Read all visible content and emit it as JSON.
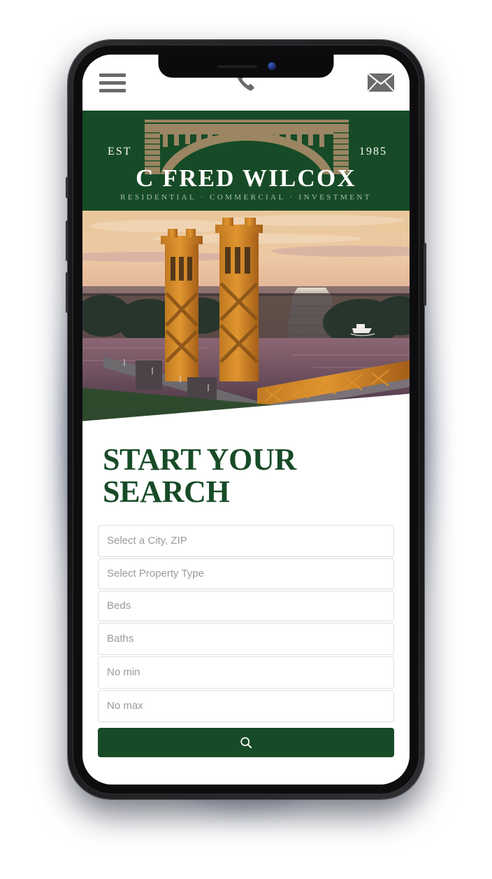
{
  "header": {
    "menu_icon": "hamburger-menu-icon",
    "phone_icon": "phone-icon",
    "mail_icon": "envelope-icon"
  },
  "logo": {
    "est_label": "EST",
    "est_year": "1985",
    "brand_name": "C FRED WILCOX",
    "tagline": "RESIDENTIAL  ·  COMMERCIAL  ·  INVESTMENT",
    "bridge_icon": "arch-bridge-icon",
    "band_color": "#174b27",
    "bridge_color": "#9b8562"
  },
  "hero": {
    "alt": "Sacramento Tower Bridge at sunset with Ziggurat building",
    "wedge_color": "#2c4a2b"
  },
  "search": {
    "title": "START YOUR SEARCH",
    "title_color": "#174b27",
    "fields": [
      {
        "name": "city-zip",
        "placeholder": "Select a City, ZIP"
      },
      {
        "name": "property-type",
        "placeholder": "Select Property Type"
      },
      {
        "name": "beds",
        "placeholder": "Beds"
      },
      {
        "name": "baths",
        "placeholder": "Baths"
      },
      {
        "name": "price-min",
        "placeholder": "No min"
      },
      {
        "name": "price-max",
        "placeholder": "No max"
      }
    ],
    "button": {
      "icon": "search-icon",
      "label": "",
      "color": "#174b27"
    }
  },
  "device": {
    "type": "smartphone-mockup",
    "notch": true
  }
}
